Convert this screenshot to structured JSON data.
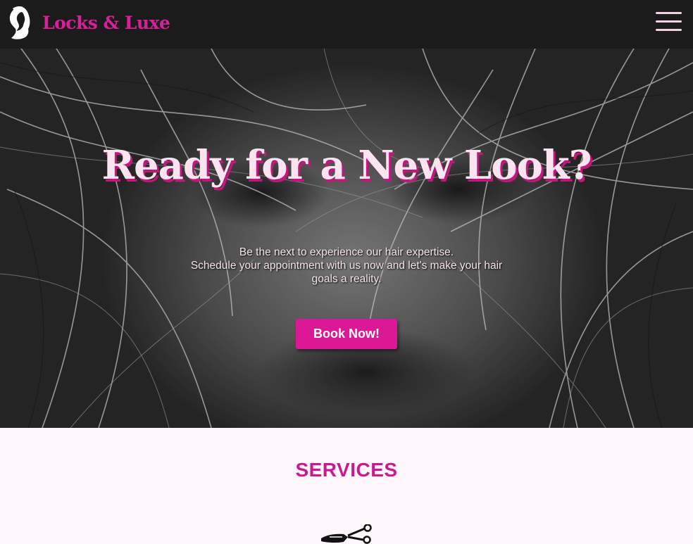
{
  "header": {
    "brand_name": "Locks & Luxe",
    "logo_icon": "woman-silhouette-icon",
    "menu_icon": "hamburger-menu-icon"
  },
  "hero": {
    "title": "Ready for a New Look?",
    "text_lines": [
      "Be the next to experience our hair expertise.",
      "Schedule your appointment with us now and let's make your hair",
      "goals a reality."
    ],
    "book_button": "Book Now!"
  },
  "services": {
    "heading": "SERVICES",
    "first_icon": "scissors-comb-icon"
  },
  "colors": {
    "accent": "#dc1896",
    "nav_background": "#1c1b1c",
    "hero_title": "#fbe3ef",
    "page_background": "#fdf7fb"
  }
}
